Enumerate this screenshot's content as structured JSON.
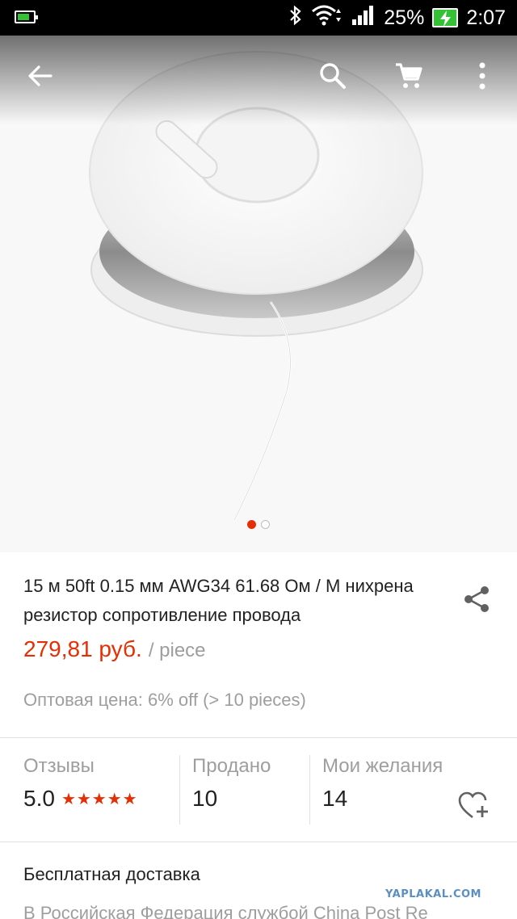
{
  "status_bar": {
    "battery_percent": "25%",
    "time": "2:07"
  },
  "image_gallery": {
    "dots_total": 2,
    "active_dot": 0
  },
  "product": {
    "title": "15 м 50ft 0.15 мм AWG34 61.68 Ом / М нихрена резистор сопротивление провода",
    "price": "279,81 руб.",
    "unit": "/ piece",
    "wholesale": "Оптовая цена: 6% off (> 10 pieces)"
  },
  "stats": {
    "reviews_label": "Отзывы",
    "reviews_value": "5.0",
    "rating_stars": "★★★★★",
    "sold_label": "Продано",
    "sold_value": "10",
    "wishlist_label": "Мои желания",
    "wishlist_value": "14"
  },
  "shipping": {
    "title": "Бесплатная доставка",
    "description": "В Российская Федерация службой China Post Re"
  },
  "watermark": "YAPLAKAL.COM",
  "colors": {
    "accent": "#e62e04",
    "muted_text": "#9e9e9e",
    "status_bar": "#000000"
  }
}
